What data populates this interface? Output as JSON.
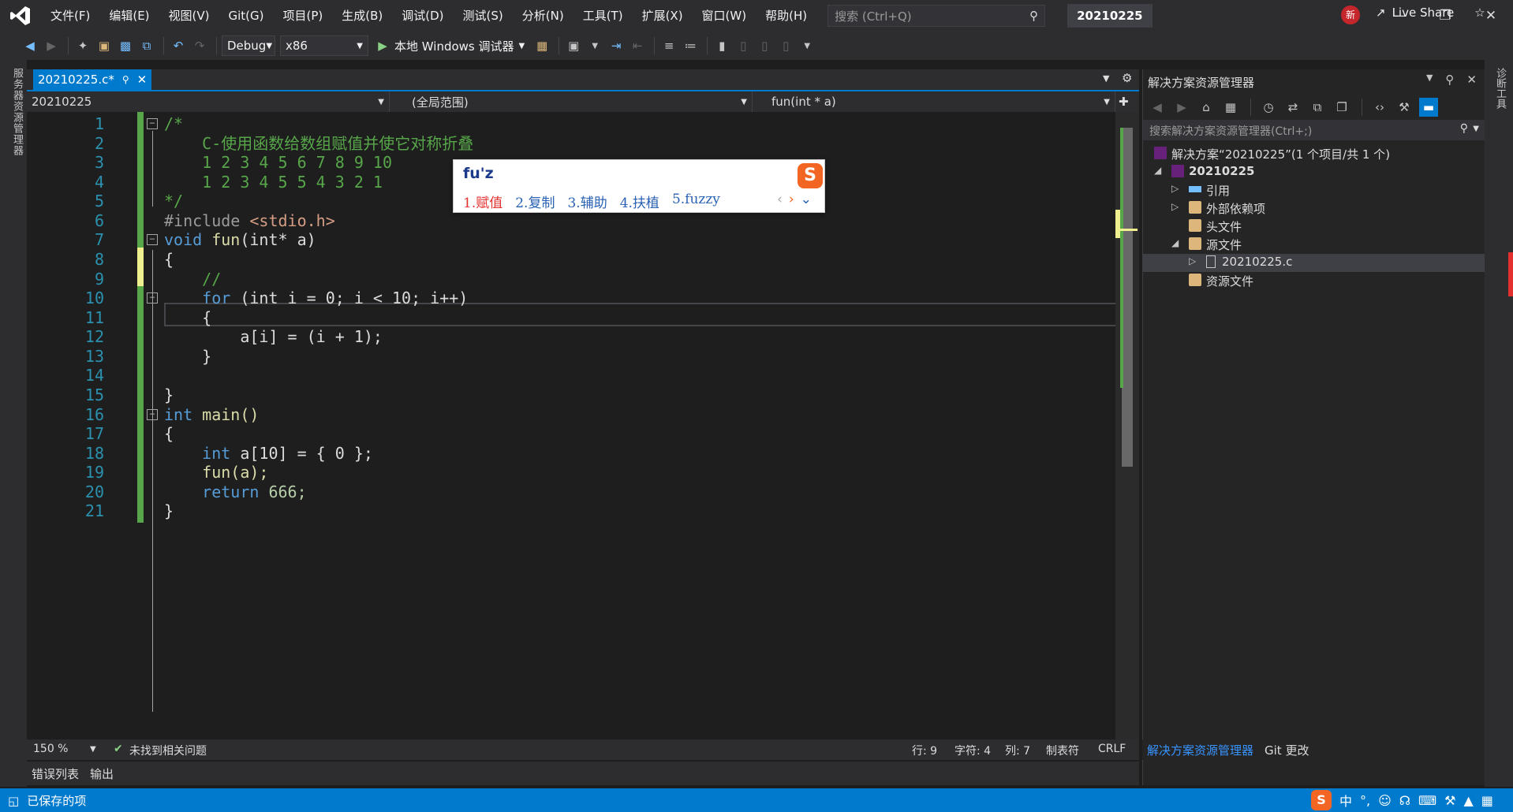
{
  "window": {
    "menu": [
      "文件(F)",
      "编辑(E)",
      "视图(V)",
      "Git(G)",
      "项目(P)",
      "生成(B)",
      "调试(D)",
      "测试(S)",
      "分析(N)",
      "工具(T)",
      "扩展(X)",
      "窗口(W)",
      "帮助(H)"
    ],
    "search_placeholder": "搜索 (Ctrl+Q)",
    "solution_name": "20210225",
    "badge_new": "新"
  },
  "toolbar": {
    "config": "Debug",
    "platform": "x86",
    "debugger_label": "本地 Windows 调试器",
    "live_share": "Live Share"
  },
  "left_strip_label": "服务器资源管理器",
  "right_strip_label": "诊断工具",
  "editor": {
    "tab_label": "20210225.c*",
    "nav_project": "20210225",
    "nav_scope": "(全局范围)",
    "nav_member": "fun(int * a)",
    "line_numbers": [
      "1",
      "2",
      "3",
      "4",
      "5",
      "6",
      "7",
      "8",
      "9",
      "10",
      "11",
      "12",
      "13",
      "14",
      "15",
      "16",
      "17",
      "18",
      "19",
      "20",
      "21"
    ],
    "code": {
      "l1": "/*",
      "l2": "    C-使用函数给数组赋值并使它对称折叠",
      "l3": "    1 2 3 4 5 6 7 8 9 10",
      "l4": "    1 2 3 4 5 5 4 3 2 1",
      "l5": "*/",
      "l6_a": "#include ",
      "l6_b": "<stdio.h>",
      "l7_kw": "void",
      "l7_fn": "fun",
      "l7_rest": "(int* a)",
      "l8": "{",
      "l9": "    //",
      "l10_kw": "    for",
      "l10_rest": " (int i = 0; i < 10; i++)",
      "l11": "    {",
      "l12": "        a[i] = (i + 1);",
      "l13": "    }",
      "l15": "}",
      "l16_kw": "int",
      "l16_rest": " main()",
      "l17": "{",
      "l18_kw": "    int",
      "l18_rest": " a[10] = { 0 };",
      "l19": "    fun(a);",
      "l20_kw": "    return",
      "l20_rest": " 666;",
      "l21": "}"
    }
  },
  "ime": {
    "input": "fu'z",
    "logo": "S",
    "candidates": [
      "1.赋值",
      "2.复制",
      "3.辅助",
      "4.扶植",
      "5.fuzzy"
    ]
  },
  "editor_status": {
    "zoom": "150 %",
    "issues": "未找到相关问题",
    "line": "行: 9",
    "char": "字符: 4",
    "col": "列: 7",
    "tabs": "制表符",
    "eol": "CRLF"
  },
  "bottom_tabs": [
    "错误列表",
    "输出"
  ],
  "solution_explorer": {
    "title": "解决方案资源管理器",
    "search_placeholder": "搜索解决方案资源管理器(Ctrl+;)",
    "tree": {
      "solution": "解决方案“20210225”(1 个项目/共 1 个)",
      "project": "20210225",
      "references": "引用",
      "external_deps": "外部依赖项",
      "headers": "头文件",
      "sources": "源文件",
      "source_file": "20210225.c",
      "resources": "资源文件"
    },
    "bottom_tabs": [
      "解决方案资源管理器",
      "Git 更改"
    ]
  },
  "statusbar": {
    "saved": "已保存的项",
    "ime_lang": "中"
  }
}
